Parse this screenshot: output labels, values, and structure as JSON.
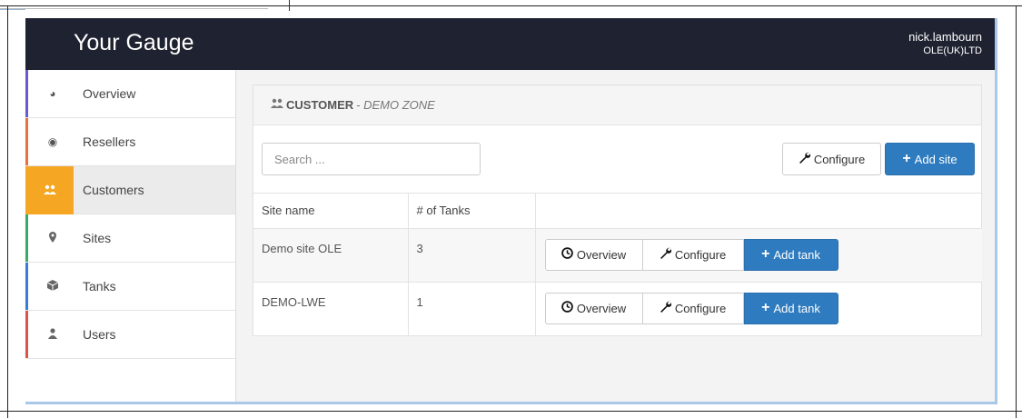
{
  "app": {
    "brand": "Your Gauge"
  },
  "user": {
    "name": "nick.lambourn",
    "org": "OLE(UK)LTD"
  },
  "sidebar": {
    "items": [
      {
        "label": "Overview",
        "icon": "dashboard-icon",
        "glyph": "◕",
        "color": "#6a5acd"
      },
      {
        "label": "Resellers",
        "icon": "globe-icon",
        "glyph": "◉",
        "color": "#e8703a"
      },
      {
        "label": "Customers",
        "icon": "users-icon",
        "glyph": "👥",
        "color": "#f5a623",
        "active": true
      },
      {
        "label": "Sites",
        "icon": "map-marker-icon",
        "glyph": "⚲",
        "color": "#3aa76d"
      },
      {
        "label": "Tanks",
        "icon": "cube-icon",
        "glyph": "⬢",
        "color": "#3a7bd5"
      },
      {
        "label": "Users",
        "icon": "user-icon",
        "glyph": "♟",
        "color": "#d9534f"
      }
    ]
  },
  "panel": {
    "title": "CUSTOMER",
    "separator": " - ",
    "subtitle": "DEMO ZONE",
    "search_placeholder": "Search ...",
    "configure_label": "Configure",
    "add_site_label": "Add site"
  },
  "table": {
    "headers": [
      "Site name",
      "# of Tanks",
      ""
    ],
    "rows": [
      {
        "site": "Demo site OLE",
        "tanks": "3"
      },
      {
        "site": "DEMO-LWE",
        "tanks": "1"
      }
    ],
    "row_actions": {
      "overview": "Overview",
      "configure": "Configure",
      "add_tank": "Add tank"
    }
  },
  "colors": {
    "topbar": "#1f2230",
    "primary": "#2e7bbf",
    "active_accent": "#f5a623"
  }
}
